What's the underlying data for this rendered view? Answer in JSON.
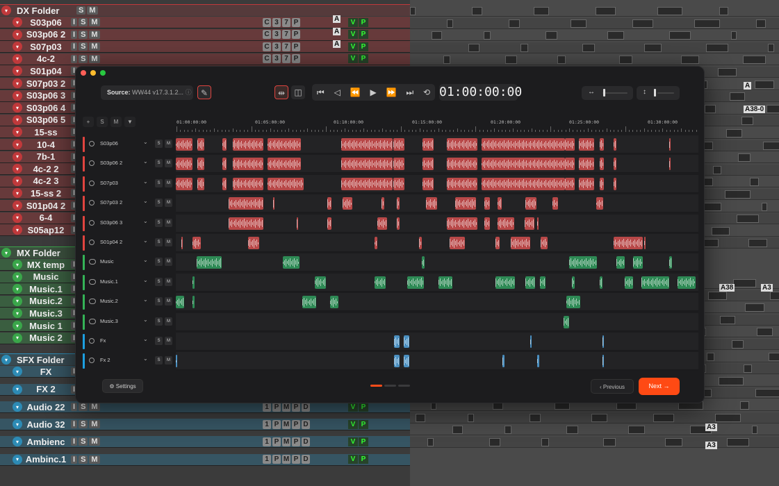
{
  "daw": {
    "folders": [
      {
        "name": "DX Folder",
        "color": "#c0393b"
      },
      {
        "name": "MX Folder",
        "color": "#3aa64a"
      },
      {
        "name": "SFX Folder",
        "color": "#2d8bb5"
      }
    ],
    "dx_tracks": [
      "S03p06",
      "S03p06 2",
      "S07p03",
      "4c-2",
      "S01p04",
      "S07p03 2",
      "S03p06 3",
      "S03p06 4",
      "S03p06 5",
      "15-ss",
      "10-4",
      "7b-1",
      "4c-2 2",
      "4c-2 3",
      "15-ss 2",
      "S01p04 2",
      "6-4",
      "S05ap12"
    ],
    "mx_tracks": [
      "MX temp",
      "Music",
      "Music.1",
      "Music.2",
      "Music.3",
      "Music 1",
      "Music 2"
    ],
    "sfx_tracks": [
      "FX",
      "FX 2",
      "Audio 22",
      "Audio 32",
      "Ambienc",
      "Ambinc.1"
    ],
    "ism": [
      "I",
      "S",
      "M"
    ],
    "folder_sm": [
      "S",
      "M"
    ],
    "cbtns": [
      "C",
      "3",
      "7",
      "P"
    ],
    "sfx_btns": [
      "1",
      "P",
      "M",
      "P",
      "D"
    ],
    "vp": [
      "V",
      "P",
      "P"
    ],
    "clip_labels": [
      "A",
      "A",
      "A",
      "A",
      "A38-0",
      "A38",
      "A3",
      "A3",
      "A3"
    ]
  },
  "modal": {
    "source_label": "Source:",
    "source_value": "WW44 v17.3.1.2...",
    "timecode": "01:00:00:00",
    "header_buttons": [
      "+",
      "S",
      "M",
      "▼"
    ],
    "ruler": [
      "01:00:00:00",
      "01:05:00:00",
      "01:10:00:00",
      "01:15:00:00",
      "01:20:00:00",
      "01:25:00:00",
      "01:30:00:00"
    ],
    "tracks": [
      {
        "name": "S03p06",
        "color": "#e0443f",
        "clipcolor": "#b84848"
      },
      {
        "name": "S03p06 2",
        "color": "#e0443f",
        "clipcolor": "#b84848"
      },
      {
        "name": "S07p03",
        "color": "#e0443f",
        "clipcolor": "#b84848"
      },
      {
        "name": "S07p03 2",
        "color": "#e0443f",
        "clipcolor": "#b84848"
      },
      {
        "name": "S03p06 3",
        "color": "#e0443f",
        "clipcolor": "#b84848"
      },
      {
        "name": "S01p04 2",
        "color": "#e0443f",
        "clipcolor": "#b84848"
      },
      {
        "name": "Music",
        "color": "#34b457",
        "clipcolor": "#2e8a55"
      },
      {
        "name": "Music.1",
        "color": "#34b457",
        "clipcolor": "#2e8a55"
      },
      {
        "name": "Music.2",
        "color": "#34b457",
        "clipcolor": "#2e8a55"
      },
      {
        "name": "Music.3",
        "color": "#34b457",
        "clipcolor": "#2e8a55"
      },
      {
        "name": "Fx",
        "color": "#1c9fe0",
        "clipcolor": "#4a8fc0"
      },
      {
        "name": "Fx 2",
        "color": "#1c9fe0",
        "clipcolor": "#4a8fc0"
      }
    ],
    "track_s": "S",
    "track_m": "M",
    "settings_label": "Settings",
    "previous_label": "Previous",
    "next_label": "Next",
    "page_current": 1,
    "page_total": 3,
    "colors": {
      "accent": "#ff4a14",
      "dialog": "#e0443f",
      "music": "#34b457",
      "fx": "#1c9fe0"
    }
  }
}
